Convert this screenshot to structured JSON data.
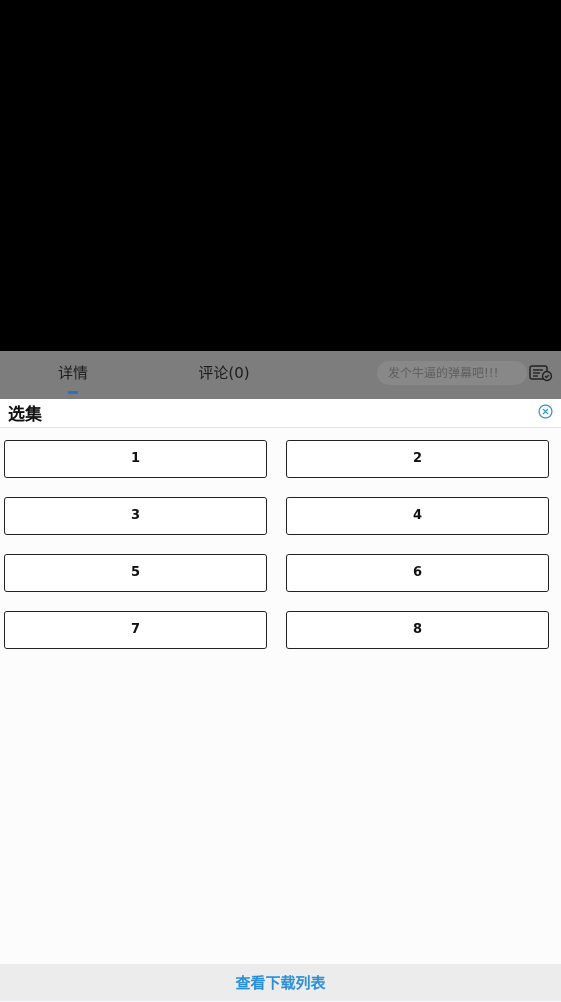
{
  "video": {},
  "tabs": {
    "details": "详情",
    "comments": "评论(0)"
  },
  "danmaku": {
    "placeholder": "发个牛逼的弹幕吧!!!",
    "toggle_icon": "danmaku-settings-icon"
  },
  "episodes_panel": {
    "title": "选集",
    "close_icon": "close-circle-icon",
    "accent": "#2a8fd6",
    "episodes": [
      "1",
      "2",
      "3",
      "4",
      "5",
      "6",
      "7",
      "8"
    ]
  },
  "footer": {
    "download_list": "查看下载列表"
  }
}
